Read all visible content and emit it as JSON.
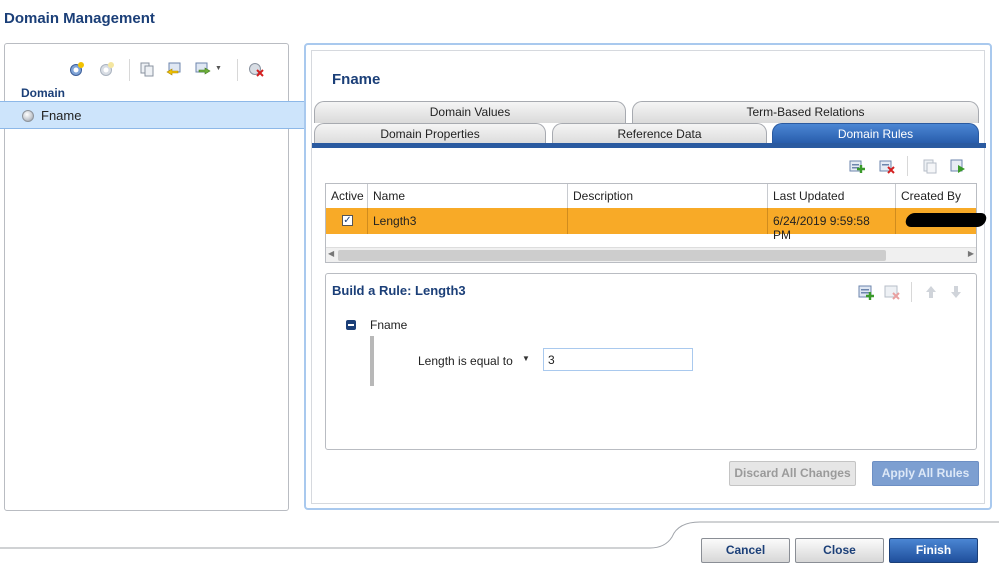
{
  "app": {
    "title": "Domain Management"
  },
  "left": {
    "domain_header": "Domain",
    "domains": [
      {
        "name": "Fname",
        "selected": true
      }
    ],
    "toolbar_icons": [
      "create-domain-icon",
      "create-composite-domain-icon",
      "copy-domain-icon",
      "import-domain-icon",
      "export-domain-icon",
      "delete-domain-icon"
    ]
  },
  "right": {
    "domain_title": "Fname",
    "tabs_back": [
      {
        "label": "Domain Values"
      },
      {
        "label": "Term-Based Relations"
      }
    ],
    "tabs_front": [
      {
        "label": "Domain Properties"
      },
      {
        "label": "Reference Data"
      },
      {
        "label": "Domain Rules",
        "active": true
      }
    ],
    "grid": {
      "columns": [
        "Active",
        "Name",
        "Description",
        "Last Updated",
        "Created By"
      ],
      "rows": [
        {
          "active": true,
          "name": "Length3",
          "description": "",
          "last_updated": "6/24/2019 9:59:58 PM",
          "created_by": "[redacted]"
        }
      ]
    },
    "build_rule": {
      "title": "Build a Rule: Length3",
      "node": "Fname",
      "condition": "Length is equal to",
      "value": "3"
    },
    "actions": {
      "discard": "Discard All Changes",
      "apply": "Apply All Rules"
    }
  },
  "footer": {
    "cancel": "Cancel",
    "close": "Close",
    "finish": "Finish"
  },
  "colors": {
    "accent": "#1b3f78",
    "selected_row": "#f8aa27",
    "active_tab": "#2559a8"
  }
}
